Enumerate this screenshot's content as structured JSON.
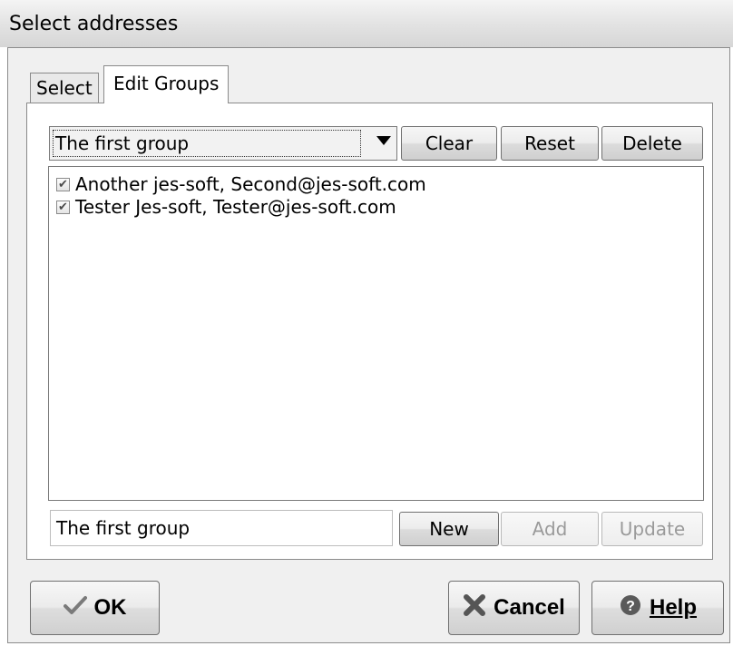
{
  "window": {
    "title": "Select addresses"
  },
  "tabs": [
    {
      "label": "Select",
      "active": false
    },
    {
      "label": "Edit Groups",
      "active": true
    }
  ],
  "group_select": {
    "value": "The first group"
  },
  "top_buttons": {
    "clear": "Clear",
    "reset": "Reset",
    "delete": "Delete"
  },
  "members": [
    {
      "label": "Another jes-soft, Second@jes-soft.com",
      "checked": true
    },
    {
      "label": "Tester Jes-soft, Tester@jes-soft.com",
      "checked": true
    }
  ],
  "group_name_field": {
    "value": "The first group"
  },
  "bottom_buttons": {
    "new": "New",
    "add": "Add",
    "update": "Update"
  },
  "footer": {
    "ok": "OK",
    "cancel": "Cancel",
    "help": "Help"
  },
  "icons": {
    "ok": "checkmark-icon",
    "cancel": "x-icon",
    "help": "help-icon"
  }
}
